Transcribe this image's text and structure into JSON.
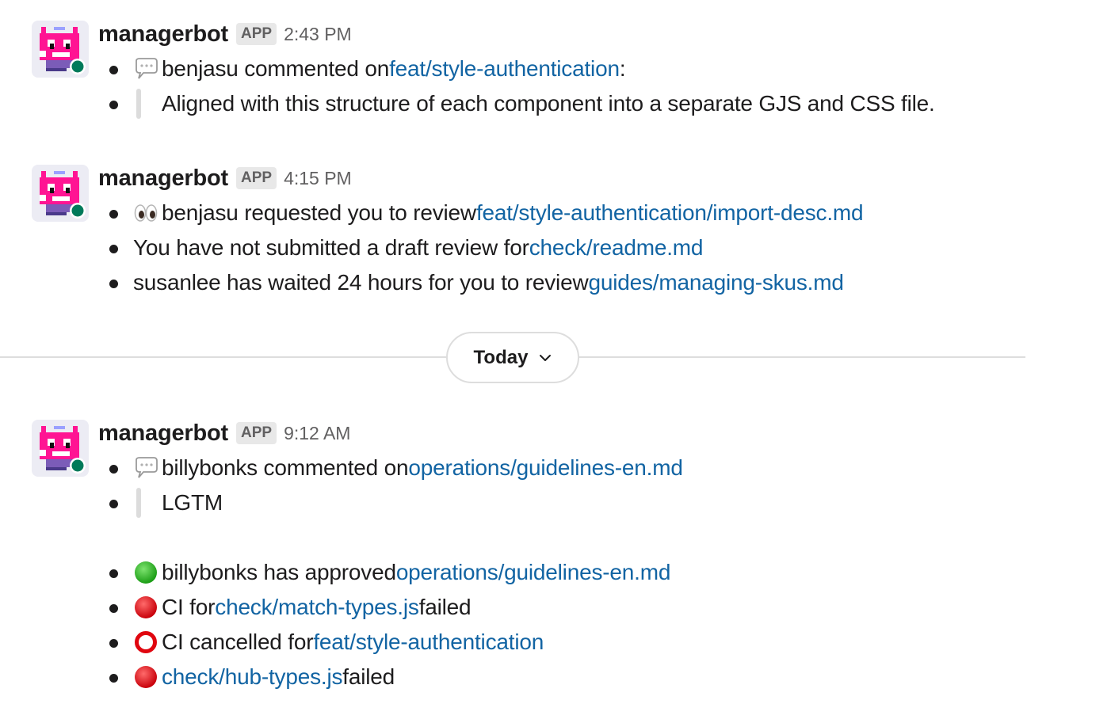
{
  "colors": {
    "link": "#1264a3",
    "text": "#1d1c1d",
    "muted": "#616061",
    "presence": "#007a5a",
    "avatar_pink": "#ff1493",
    "avatar_purple": "#7b5cb8"
  },
  "messages": [
    {
      "sender": "managerbot",
      "badge": "APP",
      "time": "2:43 PM",
      "items": [
        {
          "kind": "event",
          "emoji": "speech-bubble-icon",
          "text": "benjasu commented on ",
          "link": "feat/style-authentication",
          "suffix": ":"
        },
        {
          "kind": "quote",
          "text": "Aligned with this structure of each component into a separate GJS and CSS file."
        }
      ]
    },
    {
      "sender": "managerbot",
      "badge": "APP",
      "time": "4:15 PM",
      "items": [
        {
          "kind": "event",
          "emoji": "eyes-icon",
          "text": "benjasu requested you to review ",
          "link": "feat/style-authentication/import-desc.md"
        },
        {
          "kind": "plain",
          "text": "You have not submitted a draft review for ",
          "link": "check/readme.md"
        },
        {
          "kind": "plain",
          "text": "susanlee has waited 24 hours for you to review ",
          "link": "guides/managing-skus.md"
        }
      ]
    }
  ],
  "day_divider": {
    "label": "Today"
  },
  "message3": {
    "sender": "managerbot",
    "badge": "APP",
    "time": "9:12 AM",
    "items": [
      {
        "kind": "event",
        "emoji": "speech-bubble-icon",
        "text": "billybonks commented on ",
        "link": "operations/guidelines-en.md"
      },
      {
        "kind": "quote",
        "text": "LGTM"
      },
      {
        "kind": "event",
        "emoji": "green-circle-icon",
        "text": "billybonks has approved ",
        "link": "operations/guidelines-en.md"
      },
      {
        "kind": "event",
        "emoji": "red-circle-icon",
        "text": "CI for ",
        "link": "check/match-types.js",
        "suffix": " failed"
      },
      {
        "kind": "event",
        "emoji": "hollow-red-circle-icon",
        "text": "CI cancelled for ",
        "link": "feat/style-authentication"
      },
      {
        "kind": "event",
        "emoji": "red-circle-icon",
        "link": "check/hub-types.js",
        "suffix": " failed"
      }
    ]
  }
}
